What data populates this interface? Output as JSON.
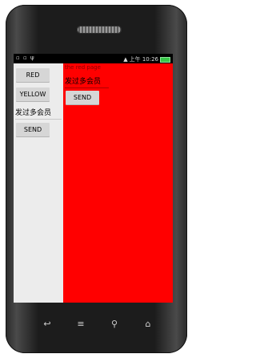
{
  "status_bar": {
    "left_icons": "▫ ▫ ψ",
    "signal": "▲",
    "time": "上午 10:26"
  },
  "left_pane": {
    "red_button": "RED",
    "yellow_button": "YELLOW",
    "text_field_value": "发过多会员",
    "send_button": "SEND"
  },
  "right_pane": {
    "title_text": "the red page",
    "text_field_value": "发过多会员",
    "send_button": "SEND",
    "background_color": "#ff0000"
  },
  "nav_bar": {
    "back": "↩",
    "home": "≡",
    "search": "⚲",
    "menu": "⌂"
  }
}
